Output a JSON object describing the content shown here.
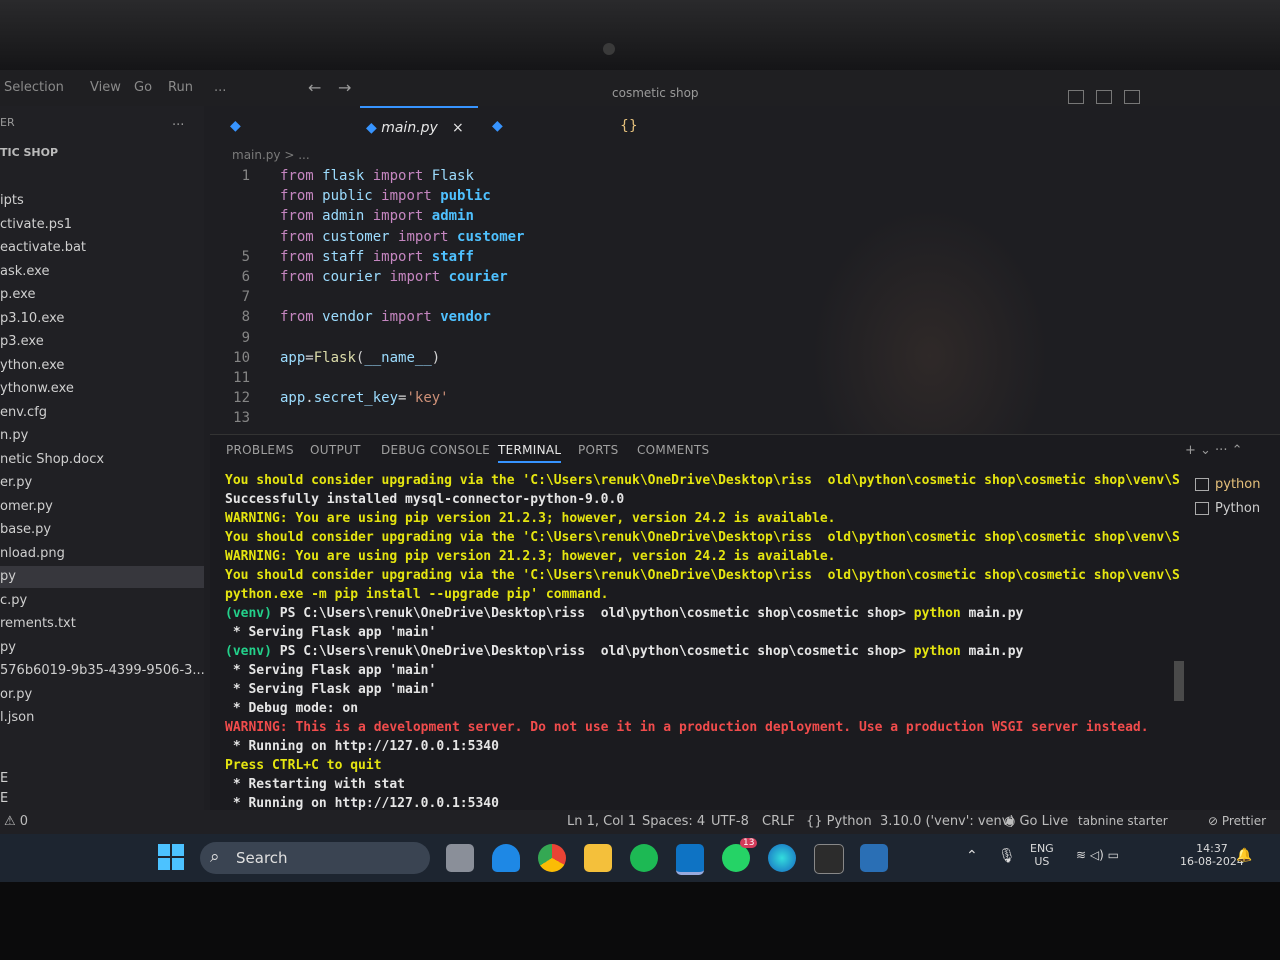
{
  "window": {
    "menu": [
      "Selection",
      "View",
      "Go",
      "Run",
      "..."
    ],
    "title": "cosmetic shop"
  },
  "sidebar": {
    "header": "ER",
    "more": "...",
    "project": "TIC SHOP",
    "files": [
      "ipts",
      "ctivate.ps1",
      "eactivate.bat",
      "ask.exe",
      "p.exe",
      "p3.10.exe",
      "p3.exe",
      "ython.exe",
      "ythonw.exe",
      "env.cfg",
      "n.py",
      "netic Shop.docx",
      "er.py",
      "omer.py",
      "base.py",
      "nload.png",
      "py",
      "c.py",
      "rements.txt",
      "py",
      "576b6019-9b35-4399-9506-3...",
      "or.py",
      "l.json"
    ],
    "active_index": 16,
    "bottom_items": [
      "E",
      "E"
    ]
  },
  "editor": {
    "tabs": [
      {
        "label": "main.py",
        "close": "×"
      }
    ],
    "breadcrumb": "main.py > ...",
    "lines": [
      {
        "n": "1",
        "parts": [
          [
            "kw",
            "from"
          ],
          [
            "plain",
            " "
          ],
          [
            "mod",
            "flask"
          ],
          [
            "plain",
            " "
          ],
          [
            "kw",
            "import"
          ],
          [
            "plain",
            " "
          ],
          [
            "mod",
            "Flask"
          ]
        ]
      },
      {
        "n": "",
        "parts": [
          [
            "kw",
            "from"
          ],
          [
            "plain",
            " "
          ],
          [
            "mod",
            "public"
          ],
          [
            "plain",
            " "
          ],
          [
            "kw",
            "import"
          ],
          [
            "plain",
            " "
          ],
          [
            "imp",
            "public"
          ]
        ]
      },
      {
        "n": "",
        "parts": [
          [
            "kw",
            "from"
          ],
          [
            "plain",
            " "
          ],
          [
            "mod",
            "admin"
          ],
          [
            "plain",
            " "
          ],
          [
            "kw",
            "import"
          ],
          [
            "plain",
            " "
          ],
          [
            "imp",
            "admin"
          ]
        ]
      },
      {
        "n": "",
        "parts": [
          [
            "kw",
            "from"
          ],
          [
            "plain",
            " "
          ],
          [
            "mod",
            "customer"
          ],
          [
            "plain",
            " "
          ],
          [
            "kw",
            "import"
          ],
          [
            "plain",
            " "
          ],
          [
            "imp",
            "customer"
          ]
        ]
      },
      {
        "n": "5",
        "parts": [
          [
            "kw",
            "from"
          ],
          [
            "plain",
            " "
          ],
          [
            "mod",
            "staff"
          ],
          [
            "plain",
            " "
          ],
          [
            "kw",
            "import"
          ],
          [
            "plain",
            " "
          ],
          [
            "imp",
            "staff"
          ]
        ]
      },
      {
        "n": "6",
        "parts": [
          [
            "kw",
            "from"
          ],
          [
            "plain",
            " "
          ],
          [
            "mod",
            "courier"
          ],
          [
            "plain",
            " "
          ],
          [
            "kw",
            "import"
          ],
          [
            "plain",
            " "
          ],
          [
            "imp",
            "courier"
          ]
        ]
      },
      {
        "n": "7",
        "parts": []
      },
      {
        "n": "8",
        "parts": [
          [
            "kw",
            "from"
          ],
          [
            "plain",
            " "
          ],
          [
            "mod",
            "vendor"
          ],
          [
            "plain",
            " "
          ],
          [
            "kw",
            "import"
          ],
          [
            "plain",
            " "
          ],
          [
            "imp",
            "vendor"
          ]
        ]
      },
      {
        "n": "9",
        "parts": []
      },
      {
        "n": "10",
        "parts": [
          [
            "var",
            "app"
          ],
          [
            "plain",
            "="
          ],
          [
            "fn",
            "Flask"
          ],
          [
            "plain",
            "("
          ],
          [
            "var",
            "__name__"
          ],
          [
            "plain",
            ")"
          ]
        ]
      },
      {
        "n": "11",
        "parts": []
      },
      {
        "n": "12",
        "parts": [
          [
            "var",
            "app"
          ],
          [
            "plain",
            "."
          ],
          [
            "var",
            "secret_key"
          ],
          [
            "plain",
            "="
          ],
          [
            "str",
            "'key'"
          ]
        ]
      },
      {
        "n": "13",
        "parts": []
      }
    ]
  },
  "panel": {
    "tabs": [
      "PROBLEMS",
      "OUTPUT",
      "DEBUG CONSOLE",
      "TERMINAL",
      "PORTS",
      "COMMENTS"
    ],
    "active_tab": "TERMINAL",
    "actions": "+ ⌄ ··· ⌃",
    "terminal_lines": [
      {
        "cls": "yellow",
        "text": "You should consider upgrading via the 'C:\\Users\\renuk\\OneDrive\\Desktop\\riss  old\\python\\cosmetic shop\\cosmetic shop\\venv\\Scripts\\"
      },
      {
        "cls": "white",
        "text": "Successfully installed mysql-connector-python-9.0.0"
      },
      {
        "cls": "yellow",
        "text": "WARNING: You are using pip version 21.2.3; however, version 24.2 is available."
      },
      {
        "cls": "yellow",
        "text": "You should consider upgrading via the 'C:\\Users\\renuk\\OneDrive\\Desktop\\riss  old\\python\\cosmetic shop\\cosmetic shop\\venv\\Scripts\\"
      },
      {
        "cls": "yellow",
        "text": "WARNING: You are using pip version 21.2.3; however, version 24.2 is available."
      },
      {
        "cls": "yellow",
        "text": "You should consider upgrading via the 'C:\\Users\\renuk\\OneDrive\\Desktop\\riss  old\\python\\cosmetic shop\\cosmetic shop\\venv\\Scripts\\"
      },
      {
        "cls": "yellow",
        "text": "python.exe -m pip install --upgrade pip' command."
      },
      {
        "cls": "white",
        "prompt": "(venv) ",
        "text": "PS C:\\Users\\renuk\\OneDrive\\Desktop\\riss  old\\python\\cosmetic shop\\cosmetic shop> ",
        "cmd": "python",
        "rest": " main.py"
      },
      {
        "cls": "white",
        "text": " * Serving Flask app 'main'"
      },
      {
        "cls": "white",
        "prompt": "(venv) ",
        "text": "PS C:\\Users\\renuk\\OneDrive\\Desktop\\riss  old\\python\\cosmetic shop\\cosmetic shop> ",
        "cmd": "python",
        "rest": " main.py"
      },
      {
        "cls": "white",
        "text": " * Serving Flask app 'main'"
      },
      {
        "cls": "white",
        "text": " * Serving Flask app 'main'"
      },
      {
        "cls": "white",
        "text": " * Debug mode: on"
      },
      {
        "cls": "red",
        "text": "WARNING: This is a development server. Do not use it in a production deployment. Use a production WSGI server instead."
      },
      {
        "cls": "white",
        "text": " * Running on http://127.0.0.1:5340"
      },
      {
        "cls": "yellow",
        "text": "Press CTRL+C to quit"
      },
      {
        "cls": "white",
        "text": " * Restarting with stat"
      },
      {
        "cls": "white",
        "text": " * Running on http://127.0.0.1:5340"
      }
    ],
    "terminals": [
      "python",
      "Python"
    ]
  },
  "statusbar": {
    "left": "⚠ 0",
    "position": "Ln 1, Col 1",
    "spaces": "Spaces: 4",
    "encoding": "UTF-8",
    "eol": "CRLF",
    "language": "{} Python",
    "interpreter": "3.10.0 ('venv': venv)",
    "golive": "Go Live",
    "tabnine": "tabnine starter",
    "prettier": "Prettier"
  },
  "taskbar": {
    "search_placeholder": "Search",
    "lang_top": "ENG",
    "lang_bottom": "US",
    "time": "14:37",
    "date": "16-08-2024",
    "whatsapp_badge": "13"
  },
  "colors": {
    "accent": "#3794ff",
    "keyword": "#c586c0",
    "terminal_yellow": "#e5e510",
    "terminal_red": "#f14c4c",
    "venv_green": "#23d18b"
  }
}
